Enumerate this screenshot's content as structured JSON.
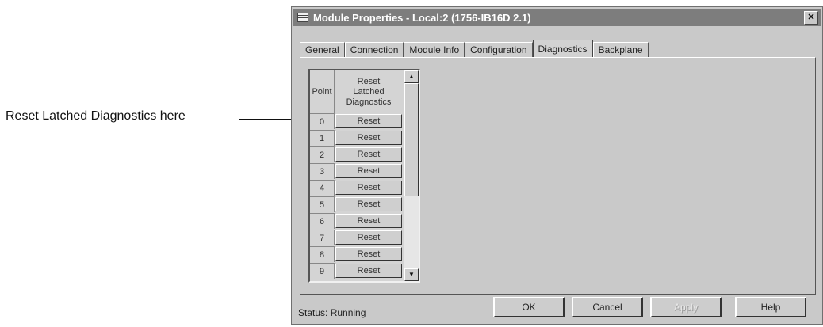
{
  "callout": {
    "label": "Reset Latched Diagnostics here"
  },
  "window": {
    "title": "Module Properties - Local:2 (1756-IB16D 2.1)",
    "close_glyph": "✕"
  },
  "tabs": [
    {
      "label": "General",
      "active": false
    },
    {
      "label": "Connection",
      "active": false
    },
    {
      "label": "Module Info",
      "active": false
    },
    {
      "label": "Configuration",
      "active": false
    },
    {
      "label": "Diagnostics",
      "active": true
    },
    {
      "label": "Backplane",
      "active": false
    }
  ],
  "grid": {
    "columns": [
      "Point",
      "Reset Latched Diagnostics"
    ],
    "rows": [
      {
        "point": "0",
        "action": "Reset"
      },
      {
        "point": "1",
        "action": "Reset"
      },
      {
        "point": "2",
        "action": "Reset"
      },
      {
        "point": "3",
        "action": "Reset"
      },
      {
        "point": "4",
        "action": "Reset"
      },
      {
        "point": "5",
        "action": "Reset"
      },
      {
        "point": "6",
        "action": "Reset"
      },
      {
        "point": "7",
        "action": "Reset"
      },
      {
        "point": "8",
        "action": "Reset"
      },
      {
        "point": "9",
        "action": "Reset"
      }
    ],
    "scroll_up_glyph": "▲",
    "scroll_down_glyph": "▼"
  },
  "status": {
    "text": "Status:  Running"
  },
  "buttons": {
    "ok": "OK",
    "cancel": "Cancel",
    "apply": "Apply",
    "help": "Help"
  },
  "icons": {
    "window": "window-icon",
    "close": "close-icon",
    "scroll_up": "scroll-up-icon",
    "scroll_down": "scroll-down-icon"
  }
}
